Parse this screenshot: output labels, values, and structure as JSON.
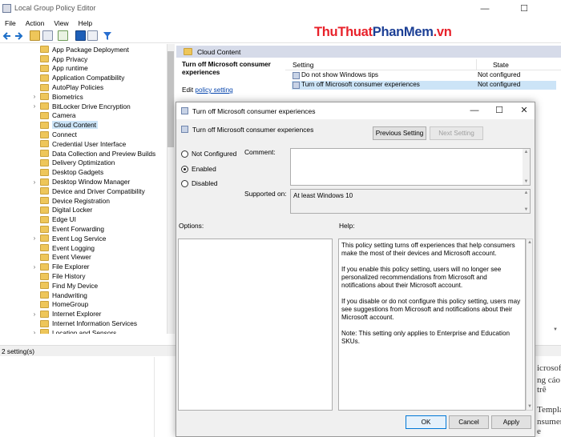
{
  "window": {
    "title": "Local Group Policy Editor",
    "minimize": "—",
    "maximize": "☐",
    "close": "✕"
  },
  "menu": [
    "File",
    "Action",
    "View",
    "Help"
  ],
  "watermark": {
    "part1": "ThuThuat",
    "part2": "PhanMem",
    "part3": ".vn"
  },
  "tree": {
    "items": [
      {
        "label": "App Package Deployment",
        "expandable": false
      },
      {
        "label": "App Privacy",
        "expandable": false
      },
      {
        "label": "App runtime",
        "expandable": false
      },
      {
        "label": "Application Compatibility",
        "expandable": false
      },
      {
        "label": "AutoPlay Policies",
        "expandable": false
      },
      {
        "label": "Biometrics",
        "expandable": true
      },
      {
        "label": "BitLocker Drive Encryption",
        "expandable": true
      },
      {
        "label": "Camera",
        "expandable": false
      },
      {
        "label": "Cloud Content",
        "expandable": false,
        "selected": true
      },
      {
        "label": "Connect",
        "expandable": false
      },
      {
        "label": "Credential User Interface",
        "expandable": false
      },
      {
        "label": "Data Collection and Preview Builds",
        "expandable": false
      },
      {
        "label": "Delivery Optimization",
        "expandable": false
      },
      {
        "label": "Desktop Gadgets",
        "expandable": false
      },
      {
        "label": "Desktop Window Manager",
        "expandable": true
      },
      {
        "label": "Device and Driver Compatibility",
        "expandable": false
      },
      {
        "label": "Device Registration",
        "expandable": false
      },
      {
        "label": "Digital Locker",
        "expandable": false
      },
      {
        "label": "Edge UI",
        "expandable": false
      },
      {
        "label": "Event Forwarding",
        "expandable": false
      },
      {
        "label": "Event Log Service",
        "expandable": true
      },
      {
        "label": "Event Logging",
        "expandable": false
      },
      {
        "label": "Event Viewer",
        "expandable": false
      },
      {
        "label": "File Explorer",
        "expandable": true
      },
      {
        "label": "File History",
        "expandable": false
      },
      {
        "label": "Find My Device",
        "expandable": false
      },
      {
        "label": "Handwriting",
        "expandable": false
      },
      {
        "label": "HomeGroup",
        "expandable": false
      },
      {
        "label": "Internet Explorer",
        "expandable": true
      },
      {
        "label": "Internet Information Services",
        "expandable": false
      },
      {
        "label": "Location and Sensors",
        "expandable": true
      }
    ]
  },
  "status": "2 setting(s)",
  "right_pane": {
    "header": "Cloud Content",
    "extended_title": "Turn off Microsoft consumer experiences",
    "edit_prefix": "Edit ",
    "edit_link": "policy setting",
    "columns": {
      "setting": "Setting",
      "state": "State"
    },
    "rows": [
      {
        "name": "Do not show Windows tips",
        "state": "Not configured"
      },
      {
        "name": "Turn off Microsoft consumer experiences",
        "state": "Not configured"
      }
    ]
  },
  "background_fragments": [
    "icrosoft",
    "ng cáo trê",
    "Templat",
    "nsumer e"
  ],
  "dialog": {
    "title": "Turn off Microsoft consumer experiences",
    "setting_name": "Turn off Microsoft consumer experiences",
    "prev_button": "Previous Setting",
    "next_button": "Next Setting",
    "radios": {
      "not_configured": "Not Configured",
      "enabled": "Enabled",
      "disabled": "Disabled"
    },
    "selected_radio": "enabled",
    "comment_label": "Comment:",
    "supported_label": "Supported on:",
    "supported_value": "At least Windows 10",
    "options_label": "Options:",
    "help_label": "Help:",
    "help": [
      "This policy setting turns off experiences that help consumers make the most of their devices and Microsoft account.",
      "If you enable this policy setting, users will no longer see personalized recommendations from Microsoft and notifications about their Microsoft account.",
      "If you disable or do not configure this policy setting, users may see suggestions from Microsoft and notifications about their Microsoft account.",
      "Note: This setting only applies to Enterprise and Education SKUs."
    ],
    "ok": "OK",
    "cancel": "Cancel",
    "apply": "Apply"
  }
}
